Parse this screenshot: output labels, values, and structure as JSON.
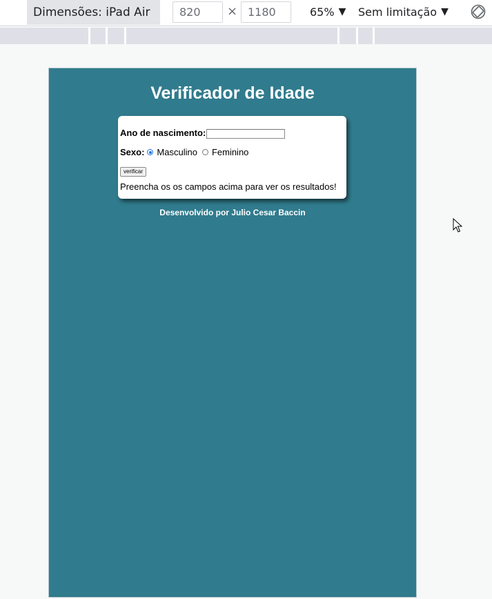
{
  "devtools": {
    "device_label": "Dimensões: iPad Air",
    "width_value": "820",
    "times_symbol": "×",
    "height_value": "1180",
    "zoom_label": "65%",
    "throttle_label": "Sem limitação",
    "dropdown_glyph": "▼"
  },
  "page": {
    "title": "Verificador de Idade",
    "birth_label": "Ano de nascimento:",
    "birth_value": "",
    "sex_label": "Sexo:",
    "options": [
      "Masculino",
      "Feminino"
    ],
    "selected_option": "Masculino",
    "verify_button": "verificar",
    "result_text": "Preencha os os campos acima para ver os resultados!",
    "footer_prefix": "Desenvolvido por ",
    "footer_author": "Julio Cesar Baccin"
  },
  "colors": {
    "page_background": "#307b8d",
    "card_background": "#ffffff",
    "radio_accent": "#1a73e8"
  }
}
